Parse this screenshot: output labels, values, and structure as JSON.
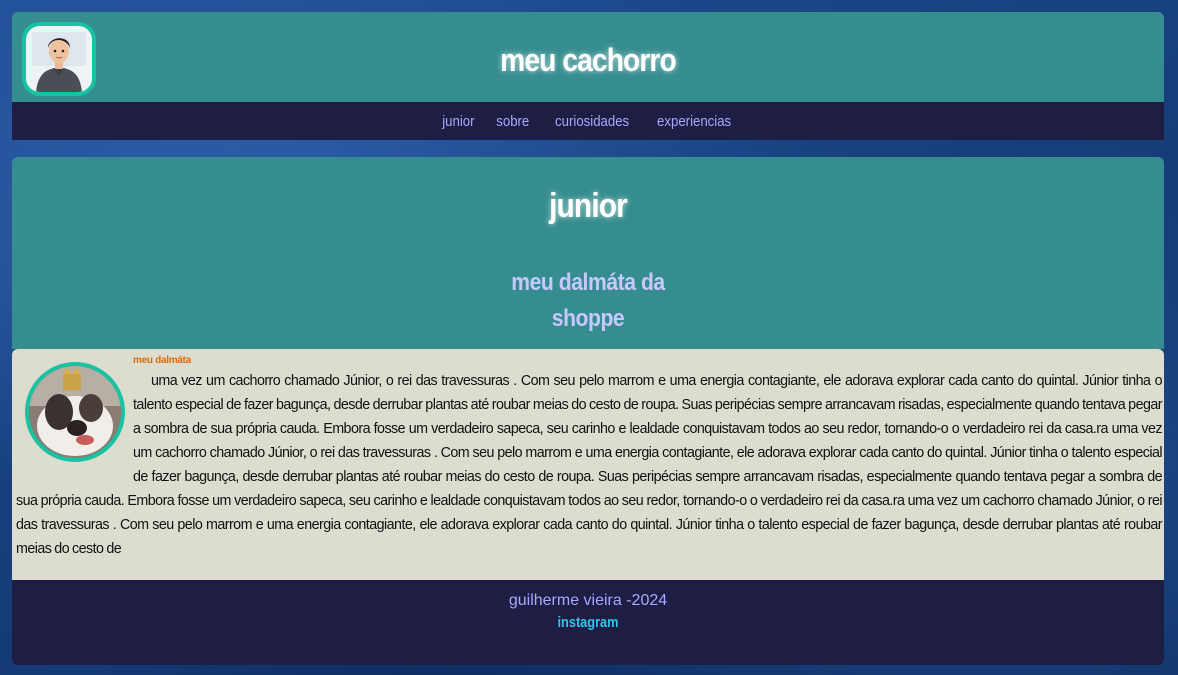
{
  "header": {
    "title": "meu cachorro",
    "avatar_icon": "user-avatar-icon"
  },
  "nav": {
    "items": [
      "junior",
      "sobre",
      "curiosidades",
      "experiencias"
    ]
  },
  "hero": {
    "title": "junior",
    "subtitle": "meu dalmáta da shoppe"
  },
  "article": {
    "image_icon": "dog-photo-icon",
    "caption": "meu dalmáta",
    "text": "uma vez um cachorro chamado Júnior, o rei das travessuras . Com seu pelo marrom e uma energia contagiante, ele adorava explorar cada canto do quintal. Júnior tinha o talento especial de fazer bagunça, desde derrubar plantas até roubar meias do cesto de roupa. Suas peripécias sempre arrancavam risadas, especialmente quando tentava pegar a sombra de sua própria cauda. Embora fosse um verdadeiro sapeca, seu carinho e lealdade conquistavam todos ao seu redor, tornando-o o verdadeiro rei da casa.ra uma vez um cachorro chamado Júnior, o rei das travessuras . Com seu pelo marrom e uma energia contagiante, ele adorava explorar cada canto do quintal. Júnior tinha o talento especial de fazer bagunça, desde derrubar plantas até roubar meias do cesto de roupa. Suas peripécias sempre arrancavam risadas, especialmente quando tentava pegar a sombra de sua própria cauda. Embora fosse um verdadeiro sapeca, seu carinho e lealdade conquistavam todos ao seu redor, tornando-o o verdadeiro rei da casa.ra uma vez um cachorro chamado Júnior, o rei das travessuras . Com seu pelo marrom e uma energia contagiante, ele adorava explorar cada canto do quintal. Júnior tinha o talento especial de fazer bagunça, desde derrubar plantas até roubar meias do cesto de"
  },
  "footer": {
    "copyright": "guilherme vieira -2024",
    "link": "instagram"
  },
  "colors": {
    "teal": "#368d8f",
    "navy": "#1e1e44",
    "accent_border": "#17c3a2",
    "nav_link": "#a8a8ff",
    "article_bg": "#dcdccf",
    "caption": "#e06a00",
    "footer_link": "#2ec6e6"
  }
}
